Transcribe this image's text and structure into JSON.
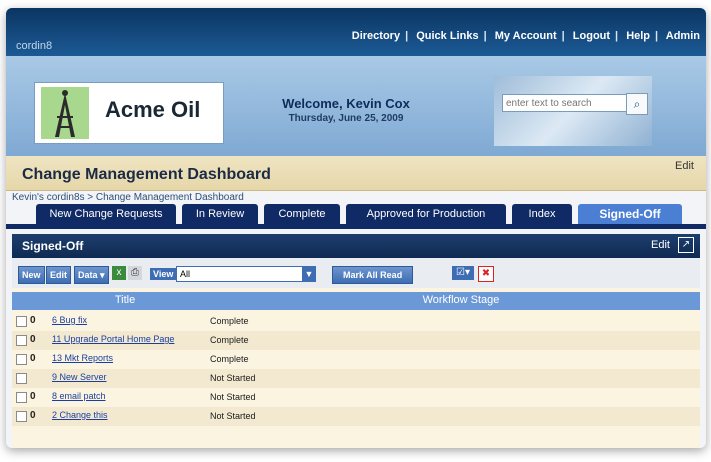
{
  "top": {
    "brand": "cordin8",
    "links": [
      "Directory",
      "Quick Links",
      "My Account",
      "Logout",
      "Help",
      "Admin"
    ]
  },
  "header": {
    "company": "Acme Oil",
    "welcome": "Welcome, Kevin Cox",
    "date": "Thursday, June 25, 2009",
    "search_placeholder": "enter text to search"
  },
  "page": {
    "title": "Change Management Dashboard",
    "edit": "Edit",
    "breadcrumb": "Kevin's cordin8s  > Change Management Dashboard"
  },
  "tabs": [
    {
      "label": "New Change Requests"
    },
    {
      "label": "In Review"
    },
    {
      "label": "Complete"
    },
    {
      "label": "Approved for Production"
    },
    {
      "label": "Index"
    },
    {
      "label": "Signed-Off",
      "active": true
    }
  ],
  "panel": {
    "title": "Signed-Off",
    "edit": "Edit",
    "toolbar": {
      "new": "New",
      "edit": "Edit",
      "data": "Data ▾",
      "view_label": "View",
      "view_value": "All",
      "mark_all_read": "Mark All Read"
    },
    "columns": {
      "title": "Title",
      "stage": "Workflow Stage"
    },
    "rows": [
      {
        "attach": "0",
        "title": "6 Bug fix",
        "stage": "Complete"
      },
      {
        "attach": "0",
        "title": "11 Upgrade Portal Home Page",
        "stage": "Complete"
      },
      {
        "attach": "0",
        "title": "13 Mkt Reports",
        "stage": "Complete"
      },
      {
        "attach": "",
        "title": "9 New Server",
        "stage": "Not Started"
      },
      {
        "attach": "0",
        "title": "8 email patch",
        "stage": "Not Started"
      },
      {
        "attach": "0",
        "title": "2 Change this",
        "stage": "Not Started"
      }
    ]
  }
}
